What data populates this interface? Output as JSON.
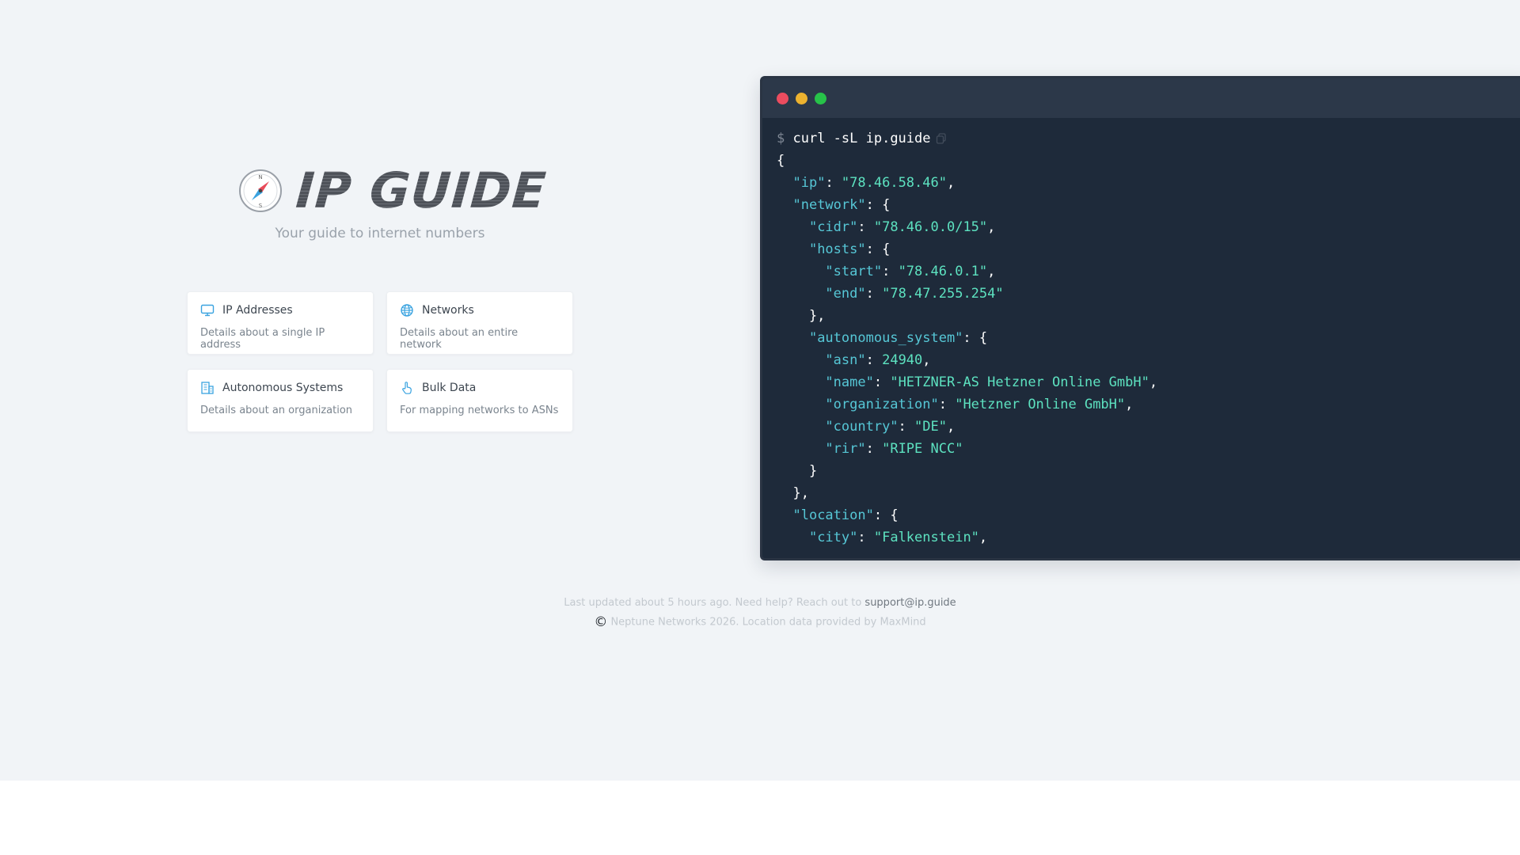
{
  "brand": {
    "name": "IP GUIDE",
    "tagline": "Your guide to internet numbers"
  },
  "cards": [
    {
      "title": "IP Addresses",
      "desc": "Details about a single IP address",
      "icon": "monitor-icon"
    },
    {
      "title": "Networks",
      "desc": "Details about an entire network",
      "icon": "globe-icon"
    },
    {
      "title": "Autonomous Systems",
      "desc": "Details about an organization",
      "icon": "building-icon"
    },
    {
      "title": "Bulk Data",
      "desc": "For mapping networks to ASNs",
      "icon": "hand-pointer-icon"
    }
  ],
  "terminal": {
    "colors": {
      "close": "#ec4c5f",
      "minimize": "#ecb22f",
      "maximize": "#27c249"
    },
    "prompt": "$",
    "command": "curl -sL ip.guide",
    "lines": [
      [
        {
          "t": "{",
          "c": "punct"
        }
      ],
      [
        {
          "t": "  "
        },
        {
          "t": "\"ip\"",
          "c": "key"
        },
        {
          "t": ": "
        },
        {
          "t": "\"78.46.58.46\"",
          "c": "str"
        },
        {
          "t": ","
        }
      ],
      [
        {
          "t": "  "
        },
        {
          "t": "\"network\"",
          "c": "key"
        },
        {
          "t": ": {"
        }
      ],
      [
        {
          "t": "    "
        },
        {
          "t": "\"cidr\"",
          "c": "key"
        },
        {
          "t": ": "
        },
        {
          "t": "\"78.46.0.0/15\"",
          "c": "str"
        },
        {
          "t": ","
        }
      ],
      [
        {
          "t": "    "
        },
        {
          "t": "\"hosts\"",
          "c": "key"
        },
        {
          "t": ": {"
        }
      ],
      [
        {
          "t": "      "
        },
        {
          "t": "\"start\"",
          "c": "key"
        },
        {
          "t": ": "
        },
        {
          "t": "\"78.46.0.1\"",
          "c": "str"
        },
        {
          "t": ","
        }
      ],
      [
        {
          "t": "      "
        },
        {
          "t": "\"end\"",
          "c": "key"
        },
        {
          "t": ": "
        },
        {
          "t": "\"78.47.255.254\"",
          "c": "str"
        }
      ],
      [
        {
          "t": "    },"
        }
      ],
      [
        {
          "t": "    "
        },
        {
          "t": "\"autonomous_system\"",
          "c": "key"
        },
        {
          "t": ": {"
        }
      ],
      [
        {
          "t": "      "
        },
        {
          "t": "\"asn\"",
          "c": "key"
        },
        {
          "t": ": "
        },
        {
          "t": "24940",
          "c": "num"
        },
        {
          "t": ","
        }
      ],
      [
        {
          "t": "      "
        },
        {
          "t": "\"name\"",
          "c": "key"
        },
        {
          "t": ": "
        },
        {
          "t": "\"HETZNER-AS Hetzner Online GmbH\"",
          "c": "str"
        },
        {
          "t": ","
        }
      ],
      [
        {
          "t": "      "
        },
        {
          "t": "\"organization\"",
          "c": "key"
        },
        {
          "t": ": "
        },
        {
          "t": "\"Hetzner Online GmbH\"",
          "c": "str"
        },
        {
          "t": ","
        }
      ],
      [
        {
          "t": "      "
        },
        {
          "t": "\"country\"",
          "c": "key"
        },
        {
          "t": ": "
        },
        {
          "t": "\"DE\"",
          "c": "str"
        },
        {
          "t": ","
        }
      ],
      [
        {
          "t": "      "
        },
        {
          "t": "\"rir\"",
          "c": "key"
        },
        {
          "t": ": "
        },
        {
          "t": "\"RIPE NCC\"",
          "c": "str"
        }
      ],
      [
        {
          "t": "    }"
        }
      ],
      [
        {
          "t": "  },"
        }
      ],
      [
        {
          "t": "  "
        },
        {
          "t": "\"location\"",
          "c": "key"
        },
        {
          "t": ": {"
        }
      ],
      [
        {
          "t": "    "
        },
        {
          "t": "\"city\"",
          "c": "key"
        },
        {
          "t": ": "
        },
        {
          "t": "\"Falkenstein\"",
          "c": "str"
        },
        {
          "t": ","
        }
      ]
    ]
  },
  "footer": {
    "updated_text": "Last updated about 5 hours ago. Need help? Reach out to",
    "support_email": "support@ip.guide",
    "copyright_symbol": "©",
    "copyright_text": "Neptune Networks 2026. Location data provided by MaxMind"
  }
}
